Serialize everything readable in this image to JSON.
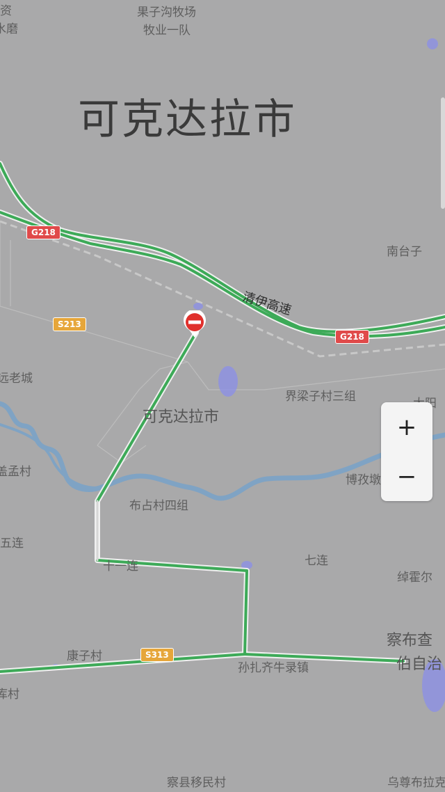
{
  "map": {
    "city_title": "可克达拉市",
    "places": [
      {
        "id": "guozigou",
        "text": "果子沟牧场"
      },
      {
        "id": "muye",
        "text": "牧业一队"
      },
      {
        "id": "zi",
        "text": "资"
      },
      {
        "id": "shuimo",
        "text": "水磨"
      },
      {
        "id": "nantaizi",
        "text": "南台子"
      },
      {
        "id": "laocheng",
        "text": "远老城"
      },
      {
        "id": "jieliangzi",
        "text": "界梁子村三组"
      },
      {
        "id": "city_small",
        "text": "可克达拉市"
      },
      {
        "id": "mengcun",
        "text": "盖孟村"
      },
      {
        "id": "bozi",
        "text": "博孜墩"
      },
      {
        "id": "buzhan",
        "text": "布占村四组"
      },
      {
        "id": "wulian",
        "text": "五连"
      },
      {
        "id": "qilian",
        "text": "七连"
      },
      {
        "id": "shiyilian",
        "text": "十一连"
      },
      {
        "id": "chuohuoer",
        "text": "绰霍尔"
      },
      {
        "id": "kangzi",
        "text": "康子村"
      },
      {
        "id": "sunzha",
        "text": "孙扎齐牛录镇"
      },
      {
        "id": "chabu1",
        "text": "察布查"
      },
      {
        "id": "chabu2",
        "text": "伯自治"
      },
      {
        "id": "cun",
        "text": "库村"
      },
      {
        "id": "chaxian",
        "text": "察县移民村"
      },
      {
        "id": "wuzun",
        "text": "乌尊布拉克"
      },
      {
        "id": "dayang",
        "text": "大阳"
      }
    ],
    "expressway_name": "清伊高速",
    "shields": [
      {
        "id": "g218a",
        "text": "G218",
        "color": "red"
      },
      {
        "id": "g218b",
        "text": "G218",
        "color": "red"
      },
      {
        "id": "s213",
        "text": "S213",
        "color": "yellow"
      },
      {
        "id": "s313",
        "text": "S313",
        "color": "yellow"
      }
    ]
  },
  "zoom": {
    "in_label": "+",
    "out_label": "−"
  },
  "colors": {
    "background": "#a9a9aa",
    "road_green": "#3daa58",
    "river": "#7fa3c4",
    "traffic_blue": "#8b8fe8"
  }
}
